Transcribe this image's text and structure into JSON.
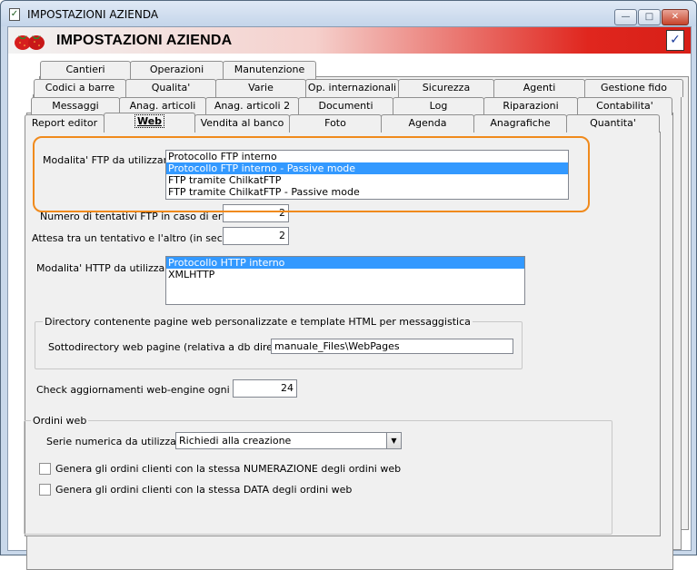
{
  "window": {
    "title": "IMPOSTAZIONI AZIENDA",
    "minimize": "0",
    "maximize": "1",
    "close": "x"
  },
  "banner": {
    "title": "IMPOSTAZIONI AZIENDA"
  },
  "tabs": {
    "row1": [
      "Cantieri",
      "Operazioni",
      "Manutenzione"
    ],
    "row2": [
      "Codici a barre",
      "Qualita'",
      "Varie",
      "Op. internazionali",
      "Sicurezza",
      "Agenti",
      "Gestione fido"
    ],
    "row3": [
      "Messaggi",
      "Anag. articoli",
      "Anag. articoli 2",
      "Documenti",
      "Log",
      "Riparazioni",
      "Contabilita'"
    ],
    "row4": [
      "Report editor",
      "Web",
      "Vendita al banco",
      "Foto",
      "Agenda",
      "Anagrafiche",
      "Quantita'"
    ],
    "active": "Web"
  },
  "ftp": {
    "label": "Modalita' FTP da utilizzare :",
    "options": [
      "Protocollo FTP interno",
      "Protocollo FTP interno - Passive mode",
      "FTP tramite ChilkatFTP",
      "FTP tramite ChilkatFTP - Passive mode"
    ],
    "selected_index": 1,
    "retries_label": "Numero di tentativi FTP in caso di errore :",
    "retries_value": "2",
    "wait_label": "Attesa tra un tentativo e l'altro (in secondi) :",
    "wait_value": "2"
  },
  "http": {
    "label": "Modalita' HTTP da utilizzare :",
    "options": [
      "Protocollo HTTP interno",
      "XMLHTTP"
    ],
    "selected_index": 0
  },
  "webdir": {
    "group_title": "Directory contenente pagine web personalizzate e template HTML per messaggistica",
    "label": "Sottodirectory web pagine (relativa a db directory) :",
    "value": "manuale_Files\\WebPages"
  },
  "update": {
    "label": "Check aggiornamenti web-engine ogni (ore) :",
    "value": "24"
  },
  "ordini": {
    "group_title": "Ordini web",
    "serie_label": "Serie numerica da utilizzare :",
    "serie_value": "Richiedi alla creazione",
    "chk1_label": "Genera gli ordini clienti con la stessa NUMERAZIONE degli ordini web",
    "chk1_checked": false,
    "chk2_label": "Genera gli ordini clienti con la stessa DATA degli ordini web",
    "chk2_checked": false
  }
}
